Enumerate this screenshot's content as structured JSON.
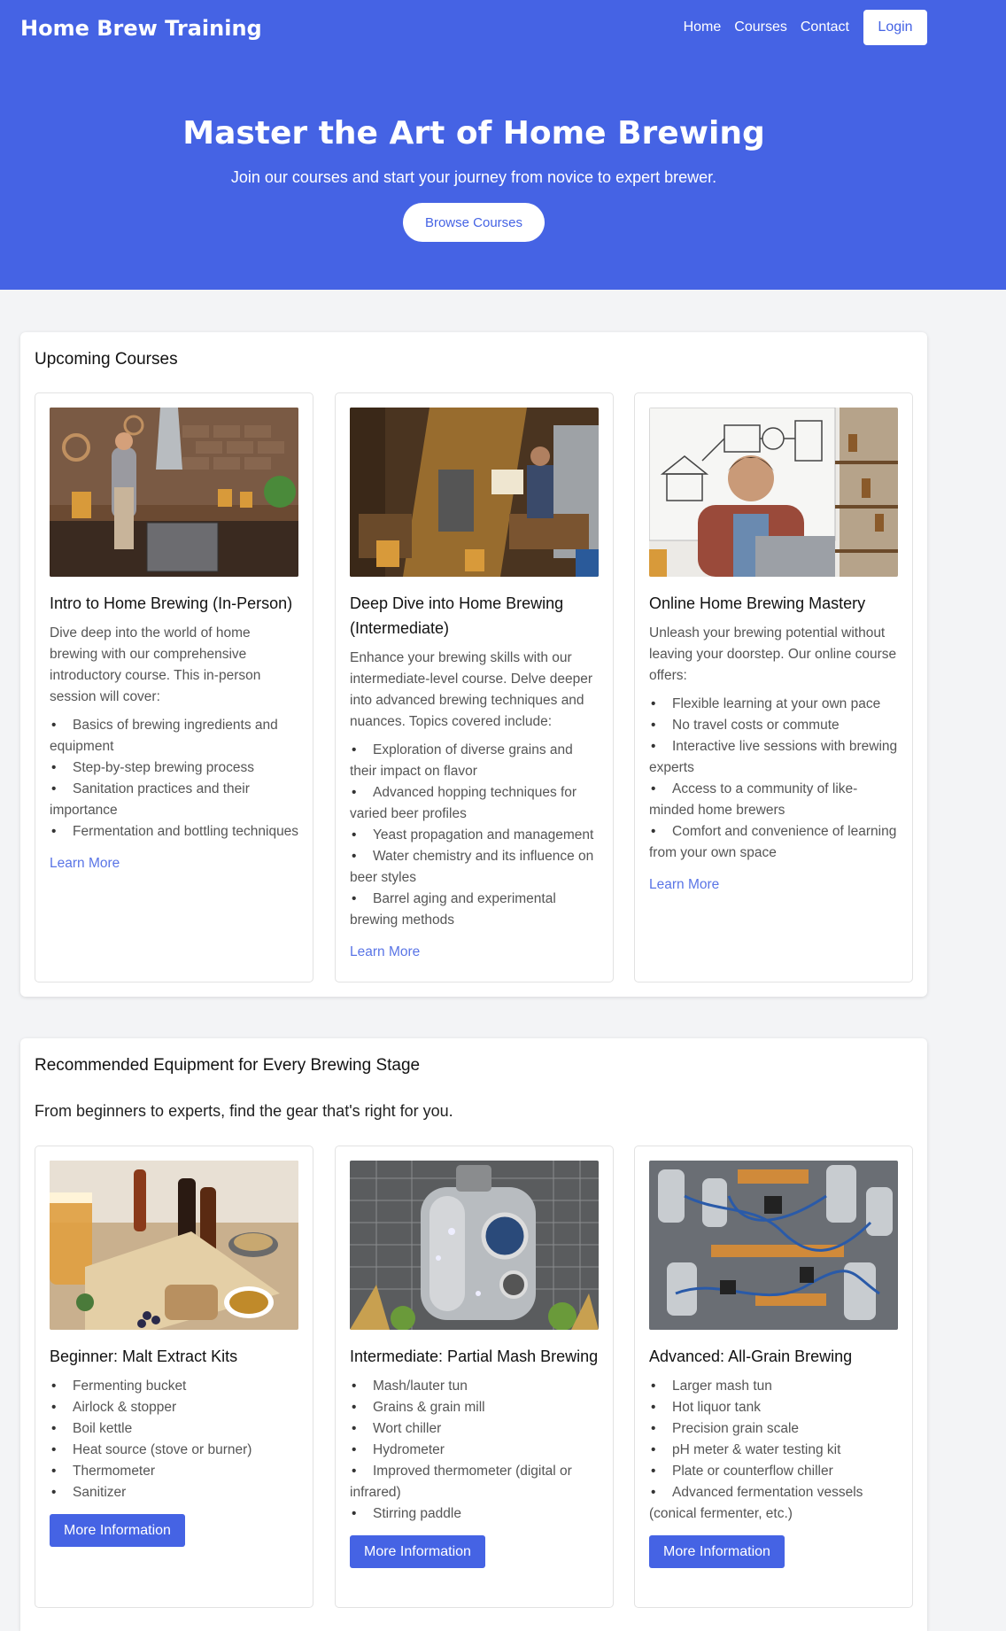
{
  "header": {
    "brand": "Home Brew Training",
    "nav": [
      "Home",
      "Courses",
      "Contact"
    ],
    "login": "Login"
  },
  "hero": {
    "title": "Master the Art of Home Brewing",
    "subtitle": "Join our courses and start your journey from novice to expert brewer.",
    "button": "Browse Courses"
  },
  "courses": {
    "title": "Upcoming Courses",
    "items": [
      {
        "title": "Intro to Home Brewing (In-Person)",
        "text": "Dive deep into the world of home brewing with our comprehensive introductory course. This in-person session will cover:",
        "list": [
          "Basics of brewing ingredients and equipment",
          "Step-by-step brewing process",
          "Sanitation practices and their importance",
          "Fermentation and bottling techniques"
        ],
        "link": "Learn More"
      },
      {
        "title": "Deep Dive into Home Brewing (Intermediate)",
        "text": "Enhance your brewing skills with our intermediate-level course. Delve deeper into advanced brewing techniques and nuances. Topics covered include:",
        "list": [
          "Exploration of diverse grains and their impact on flavor",
          "Advanced hopping techniques for varied beer profiles",
          "Yeast propagation and management",
          "Water chemistry and its influence on beer styles",
          "Barrel aging and experimental brewing methods"
        ],
        "link": "Learn More"
      },
      {
        "title": "Online Home Brewing Mastery",
        "text": "Unleash your brewing potential without leaving your doorstep. Our online course offers:",
        "list": [
          "Flexible learning at your own pace",
          "No travel costs or commute",
          "Interactive live sessions with brewing experts",
          "Access to a community of like-minded home brewers",
          "Comfort and convenience of learning from your own space"
        ],
        "link": "Learn More"
      }
    ]
  },
  "equipment": {
    "title": "Recommended Equipment for Every Brewing Stage",
    "subtitle": "From beginners to experts, find the gear that's right for you.",
    "items": [
      {
        "title": "Beginner: Malt Extract Kits",
        "list": [
          "Fermenting bucket",
          "Airlock & stopper",
          "Boil kettle",
          "Heat source (stove or burner)",
          "Thermometer",
          "Sanitizer"
        ],
        "button": "More Information"
      },
      {
        "title": "Intermediate: Partial Mash Brewing",
        "list": [
          "Mash/lauter tun",
          "Grains & grain mill",
          "Wort chiller",
          "Hydrometer",
          "Improved thermometer (digital or infrared)",
          "Stirring paddle"
        ],
        "button": "More Information"
      },
      {
        "title": "Advanced: All-Grain Brewing",
        "list": [
          "Larger mash tun",
          "Hot liquor tank",
          "Precision grain scale",
          "pH meter & water testing kit",
          "Plate or counterflow chiller",
          "Advanced fermentation vessels (conical fermenter, etc.)"
        ],
        "button": "More Information"
      }
    ]
  },
  "colors": {
    "accent": "#4563e4",
    "background": "#f3f4f6"
  }
}
